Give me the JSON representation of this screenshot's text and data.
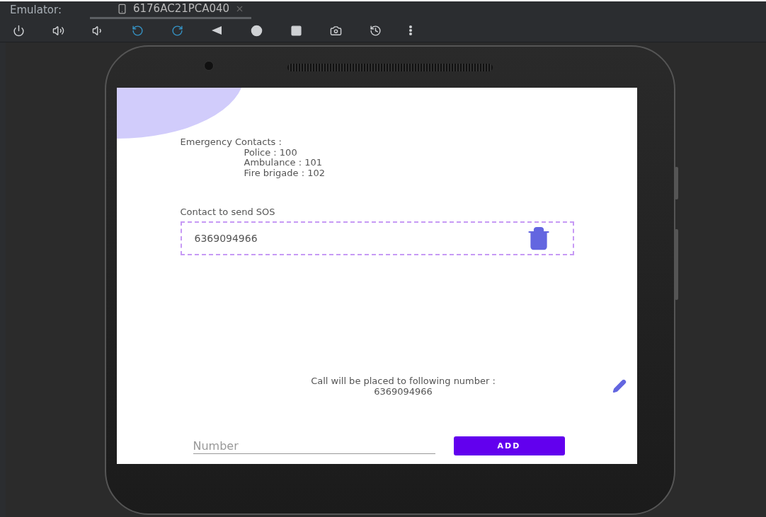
{
  "header": {
    "label": "Emulator:",
    "tabs": [
      {
        "label": "6176AC21PCA040",
        "selected": true
      }
    ]
  },
  "screen": {
    "emergency": {
      "title": "Emergency Contacts :",
      "contacts": [
        "Police : 100",
        "Ambulance : 101",
        "Fire brigade : 102"
      ]
    },
    "sos": {
      "label": "Contact to send SOS",
      "contacts": [
        "6369094966"
      ]
    },
    "call": {
      "text": "Call will be placed to following number :",
      "number": "6369094966"
    },
    "number_field": {
      "placeholder": "Number"
    },
    "add_button": "ADD"
  }
}
